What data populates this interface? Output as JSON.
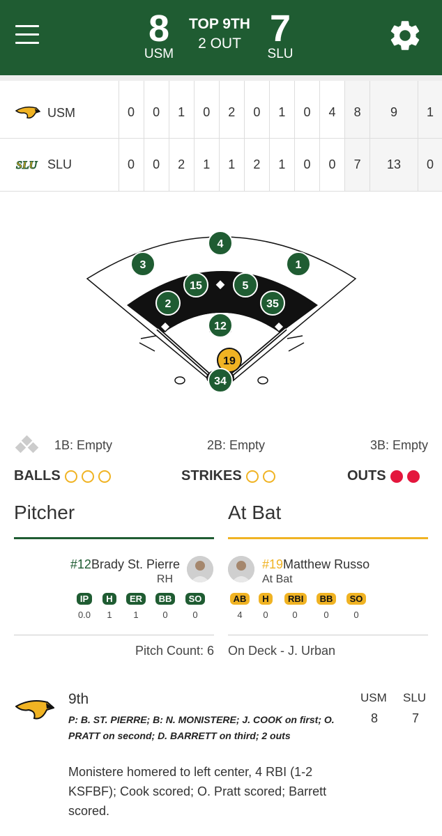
{
  "header": {
    "away_score": "8",
    "away_abbr": "USM",
    "home_score": "7",
    "home_abbr": "SLU",
    "inning": "TOP 9TH",
    "outs": "2 OUT"
  },
  "linescore": {
    "rows": [
      {
        "team": "USM",
        "innings": [
          "0",
          "0",
          "1",
          "0",
          "2",
          "0",
          "1",
          "0",
          "4"
        ],
        "r": "8",
        "h": "9",
        "e": "1"
      },
      {
        "team": "SLU",
        "innings": [
          "0",
          "0",
          "2",
          "1",
          "1",
          "2",
          "1",
          "0",
          "0"
        ],
        "r": "7",
        "h": "13",
        "e": "0"
      }
    ]
  },
  "field": {
    "positions": {
      "cf": "4",
      "lf": "3",
      "rf": "1",
      "ss": "15",
      "2b": "5",
      "3b": "2",
      "1b": "35",
      "p": "12",
      "batter": "19",
      "c": "34"
    }
  },
  "bases": {
    "first": "1B: Empty",
    "second": "2B: Empty",
    "third": "3B: Empty"
  },
  "count": {
    "balls_label": "BALLS",
    "strikes_label": "STRIKES",
    "outs_label": "OUTS"
  },
  "pitcher": {
    "section_title": "Pitcher",
    "number": "#12",
    "name": "Brady St. Pierre",
    "hand": "RH",
    "stats": [
      {
        "label": "IP",
        "value": "0.0"
      },
      {
        "label": "H",
        "value": "1"
      },
      {
        "label": "ER",
        "value": "1"
      },
      {
        "label": "BB",
        "value": "0"
      },
      {
        "label": "SO",
        "value": "0"
      }
    ],
    "pitch_count": "Pitch Count: 6"
  },
  "batter": {
    "section_title": "At Bat",
    "number": "#19",
    "name": "Matthew Russo",
    "status": "At Bat",
    "stats": [
      {
        "label": "AB",
        "value": "4"
      },
      {
        "label": "H",
        "value": "0"
      },
      {
        "label": "RBI",
        "value": "0"
      },
      {
        "label": "BB",
        "value": "0"
      },
      {
        "label": "SO",
        "value": "0"
      }
    ],
    "on_deck": "On Deck - J. Urban"
  },
  "play": {
    "inning": "9th",
    "col_away": "USM",
    "col_home": "SLU",
    "away_score": "8",
    "home_score": "7",
    "situation": "P: B. ST. PIERRE; B: N. MONISTERE; J. COOK on first; O. PRATT on second; D. BARRETT on third; 2 outs",
    "description": "Monistere homered to left center, 4 RBI (1-2 KSFBF); Cook scored; O. Pratt scored; Barrett scored."
  },
  "colors": {
    "primary_green": "#1f5c32",
    "gold": "#f0b323",
    "out_red": "#e4173d"
  }
}
